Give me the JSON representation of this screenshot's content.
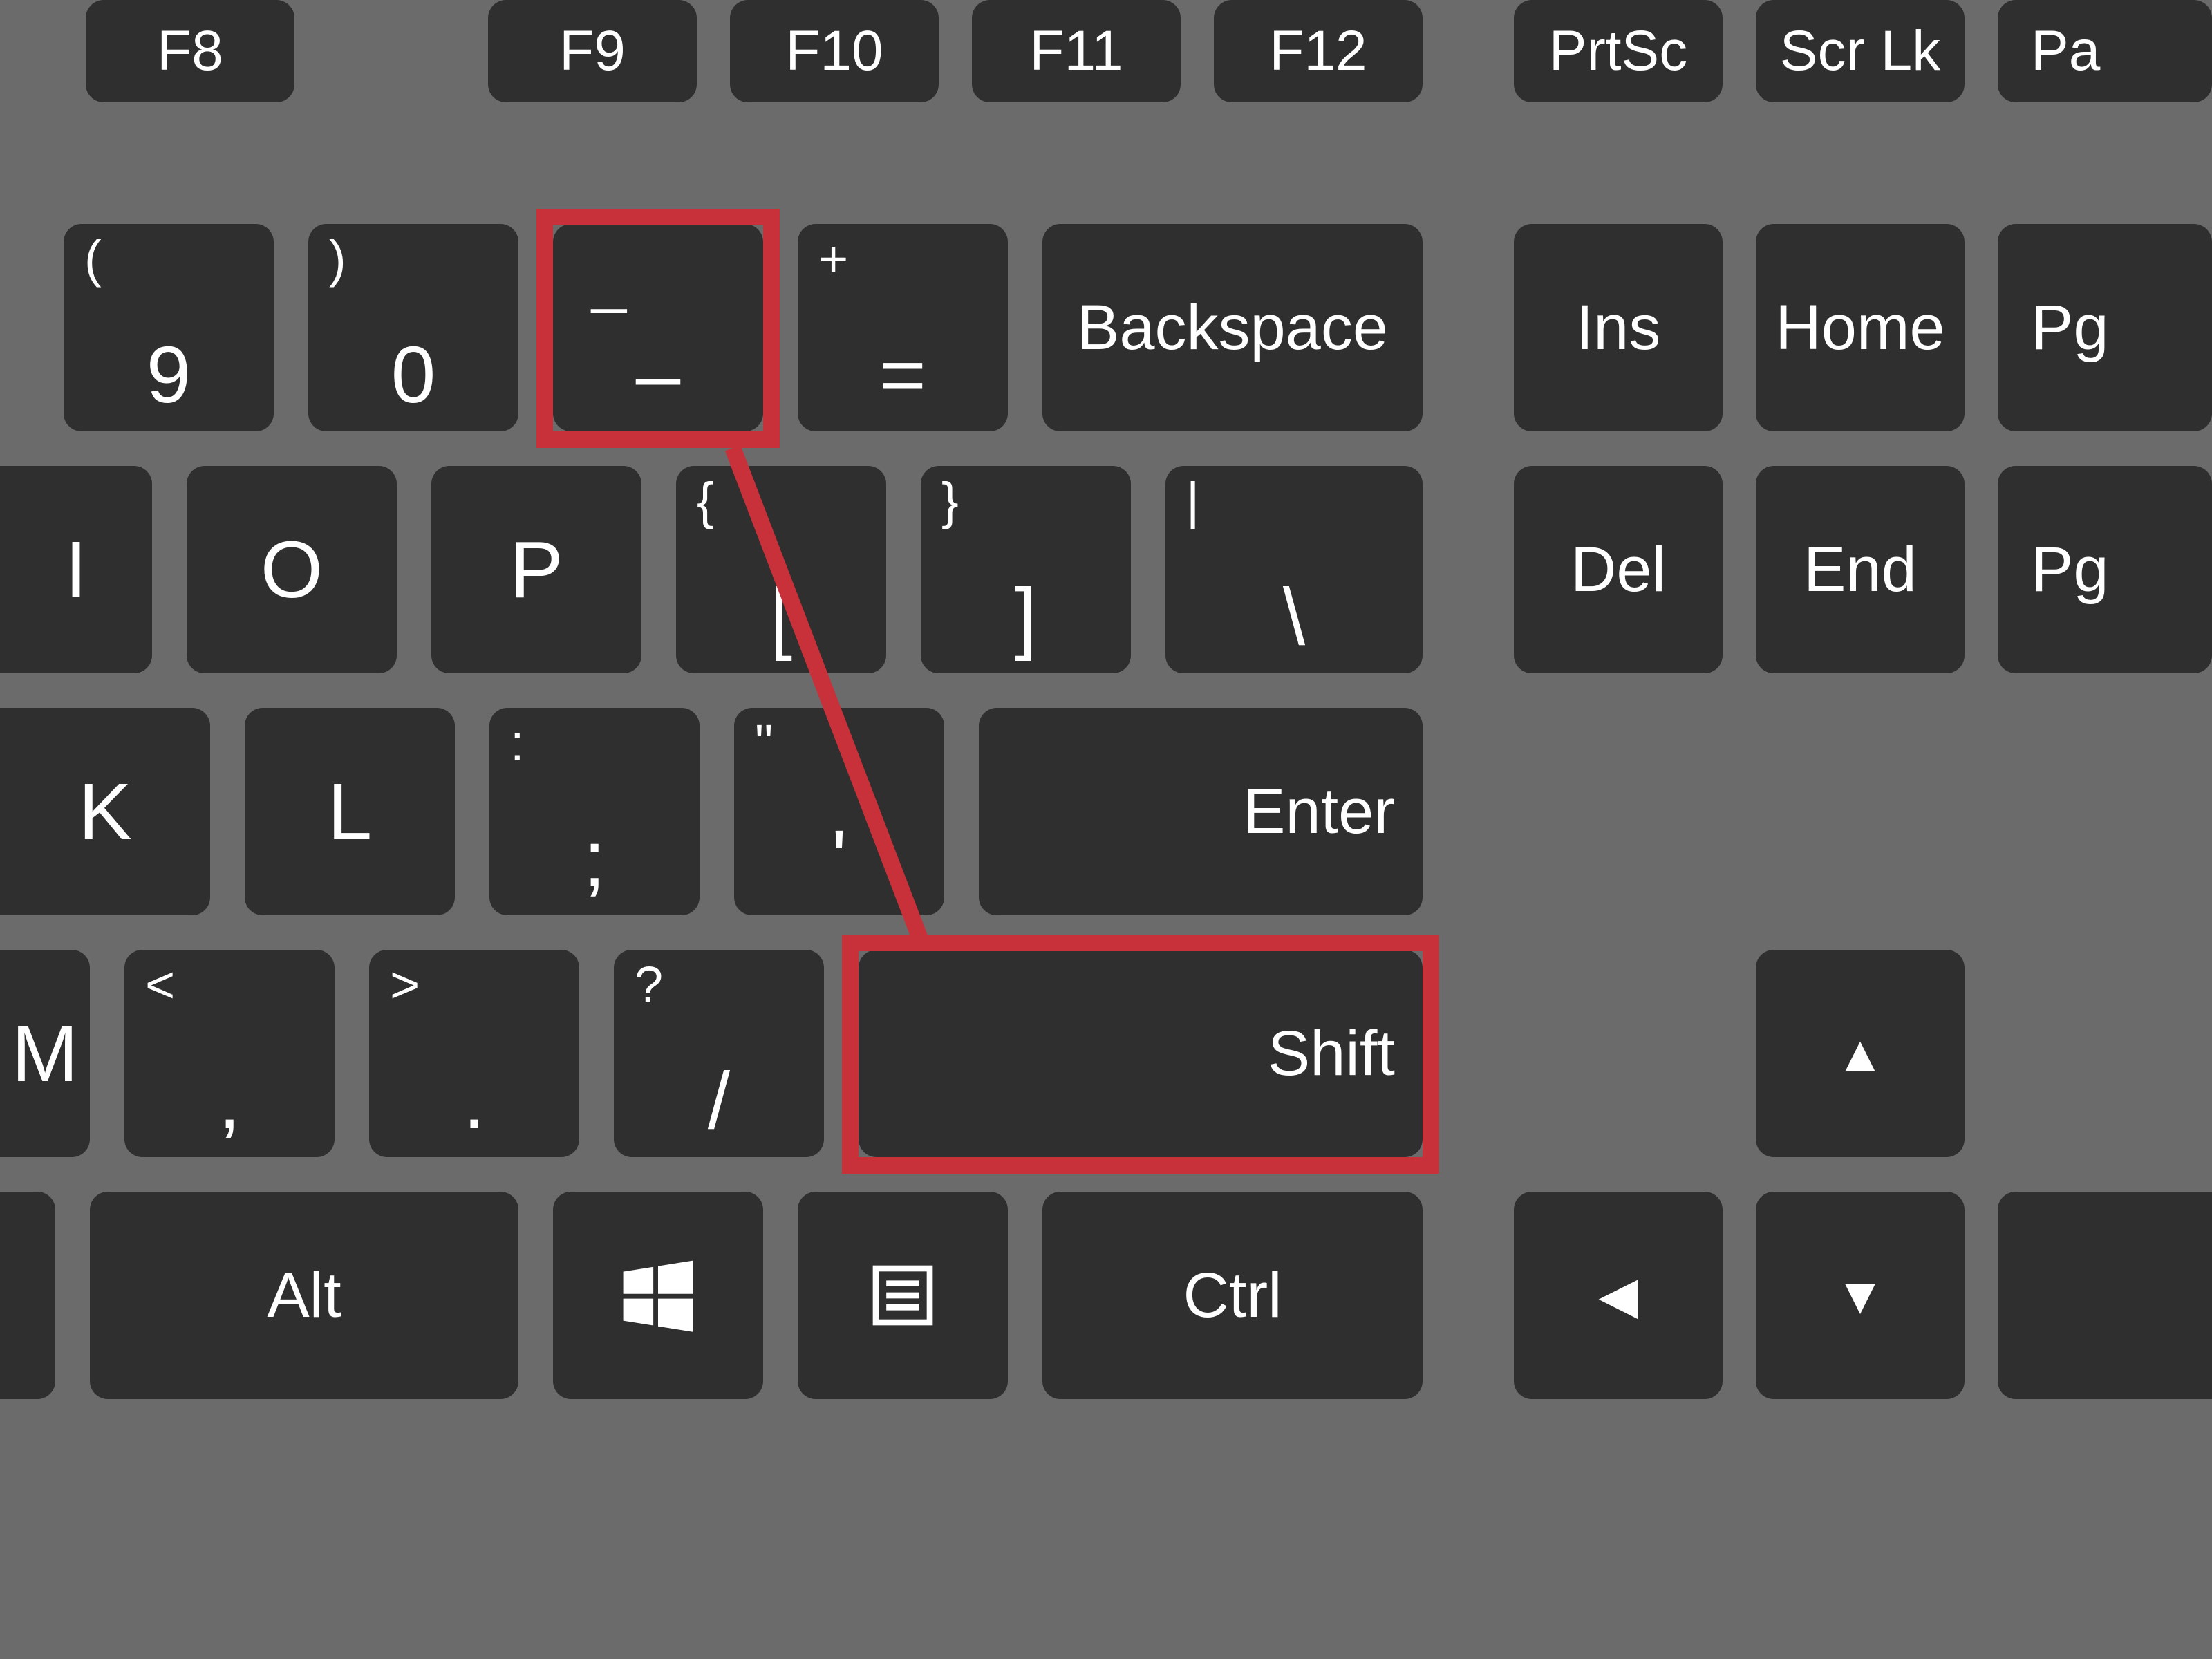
{
  "colors": {
    "bg": "#6b6b6b",
    "key": "#2f2f2f",
    "label": "#ffffff",
    "highlight": "#c8313a"
  },
  "keys": {
    "fn_f8": "F8",
    "fn_f9": "F9",
    "fn_f10": "F10",
    "fn_f11": "F11",
    "fn_f12": "F12",
    "fn_prtsc": "PrtSc",
    "fn_scrlk": "Scr Lk",
    "fn_pa": "Pa",
    "r1_9_sec": "(",
    "r1_9_main": "9",
    "r1_0_sec": ")",
    "r1_0_main": "0",
    "r1_minus_sec": "_",
    "r1_minus_main": "–",
    "r1_eq_sec": "+",
    "r1_eq_main": "=",
    "r1_backspace": "Backspace",
    "nav_ins": "Ins",
    "nav_home": "Home",
    "nav_pgup": "Pg",
    "r2_i": "I",
    "r2_o": "O",
    "r2_p": "P",
    "r2_lb_sec": "{",
    "r2_lb_main": "[",
    "r2_rb_sec": "}",
    "r2_rb_main": "]",
    "r2_bs_sec": "|",
    "r2_bs_main": "\\",
    "nav_del": "Del",
    "nav_end": "End",
    "nav_pgdn": "Pg",
    "r3_k": "K",
    "r3_l": "L",
    "r3_sc_sec": ":",
    "r3_sc_main": ";",
    "r3_q_sec": "\"",
    "r3_q_main": "'",
    "r3_enter": "Enter",
    "r4_m": "M",
    "r4_comma_sec": "<",
    "r4_comma_main": ",",
    "r4_period_sec": ">",
    "r4_period_main": ".",
    "r4_slash_sec": "?",
    "r4_slash_main": "/",
    "r4_shift": "Shift",
    "arrow_up": "▲",
    "arrow_left": "◀",
    "arrow_down": "▼",
    "r5_alt": "Alt",
    "r5_win_icon": "windows-icon",
    "r5_menu_icon": "menu-icon",
    "r5_ctrl": "Ctrl"
  }
}
